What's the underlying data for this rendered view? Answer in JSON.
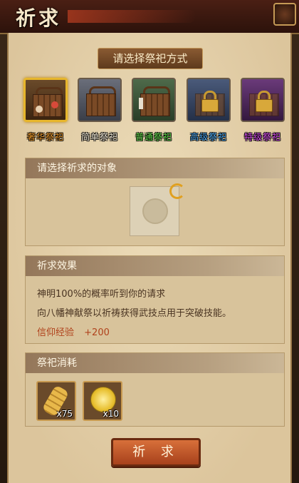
{
  "header": {
    "title": "祈求"
  },
  "method_header": "请选择祭祀方式",
  "methods": [
    {
      "label": "奢华祭祀",
      "color": "#e8962a",
      "selected": true,
      "locked": false,
      "icon": "luxury-offering-icon"
    },
    {
      "label": "简单祭祀",
      "color": "#f2ead8",
      "selected": false,
      "locked": false,
      "icon": "simple-offering-icon"
    },
    {
      "label": "普通祭祀",
      "color": "#5fd84a",
      "selected": false,
      "locked": false,
      "icon": "normal-offering-icon"
    },
    {
      "label": "高级祭祀",
      "color": "#4aa6f0",
      "selected": false,
      "locked": true,
      "icon": "lock-icon"
    },
    {
      "label": "特级祭祀",
      "color": "#d24ae8",
      "selected": false,
      "locked": true,
      "icon": "lock-icon"
    }
  ],
  "target_section": {
    "title": "请选择祈求的对象"
  },
  "effect_section": {
    "title": "祈求效果",
    "line1": "神明100%的概率听到你的请求",
    "line2": "向八幡神献祭以祈祷获得武技点用于突破技能。",
    "exp_label": "信仰经验",
    "exp_value": "+200"
  },
  "cost_section": {
    "title": "祭祀消耗",
    "items": [
      {
        "icon": "coin-roll-icon",
        "qty": "x75"
      },
      {
        "icon": "gold-coin-icon",
        "qty": "x10"
      }
    ]
  },
  "pray_button": "祈 求"
}
